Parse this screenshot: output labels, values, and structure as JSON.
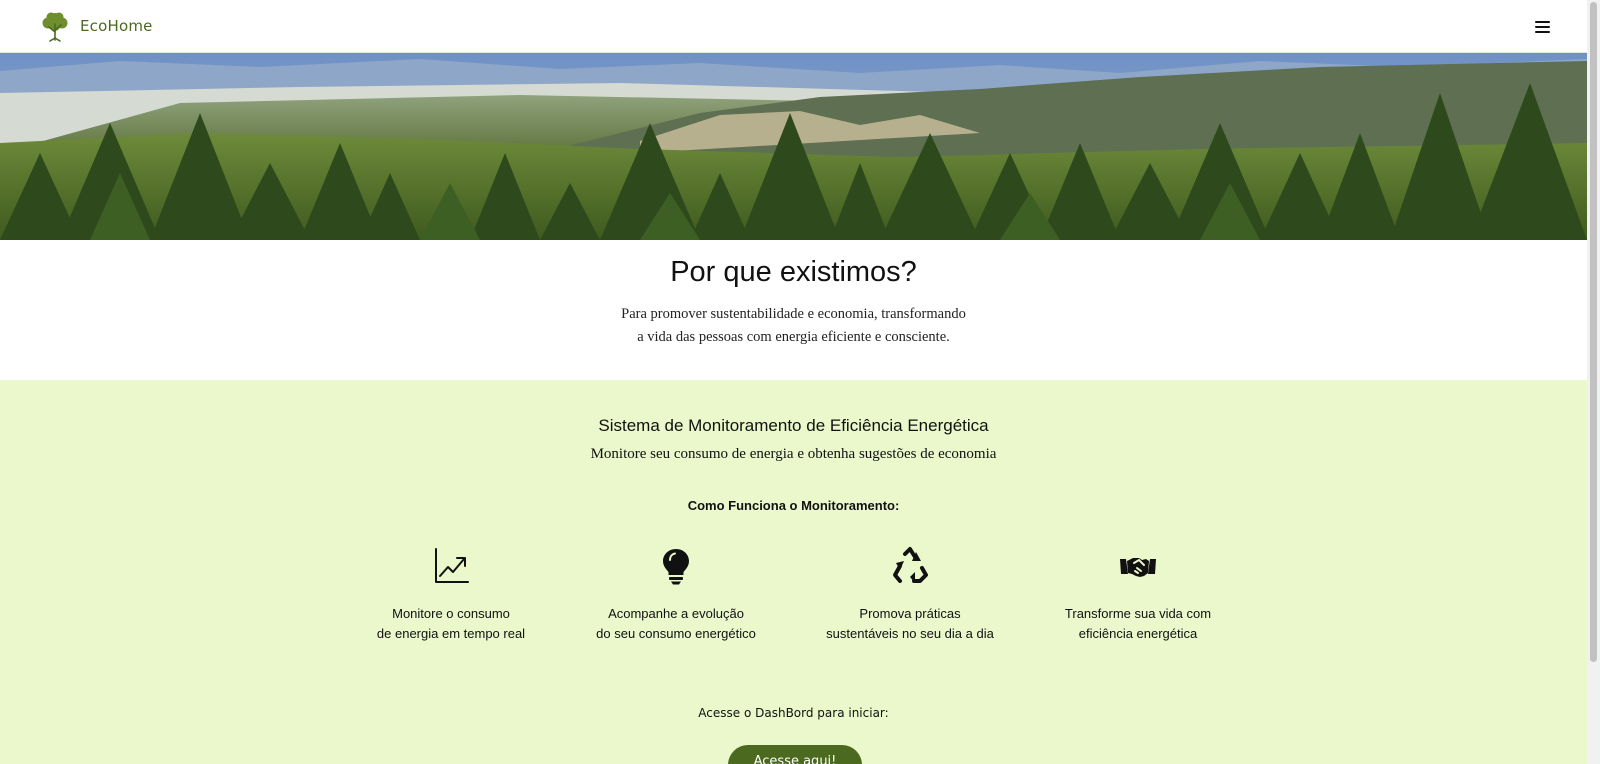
{
  "header": {
    "brand": "EcoHome",
    "logo_icon": "tree-icon",
    "menu_icon": "hamburger-menu-icon"
  },
  "why": {
    "title": "Por que existimos?",
    "text_line1": "Para promover sustentabilidade e economia, transformando",
    "text_line2": "a vida das pessoas com energia eficiente e consciente."
  },
  "monitoring": {
    "title": "Sistema de Monitoramento de Eficiência Energética",
    "subtitle": "Monitore seu consumo de energia e obtenha sugestões de economia",
    "how_title": "Como Funciona o Monitoramento:",
    "features": [
      {
        "icon": "trending-up-icon",
        "line1": "Monitore o consumo",
        "line2": "de energia em tempo real"
      },
      {
        "icon": "lightbulb-icon",
        "line1": "Acompanhe a evolução",
        "line2": "do seu consumo energético"
      },
      {
        "icon": "recycle-icon",
        "line1": "Promova práticas",
        "line2": "sustentáveis no seu dia a dia"
      },
      {
        "icon": "handshake-icon",
        "line1": "Transforme sua vida com",
        "line2": "eficiência energética"
      }
    ],
    "cta_label": "Acesse o DashBord para iniciar:",
    "cta_button": "Acesse aqui!"
  },
  "colors": {
    "brand_green": "#4b6a1f",
    "section_background": "#eaf8cb"
  }
}
